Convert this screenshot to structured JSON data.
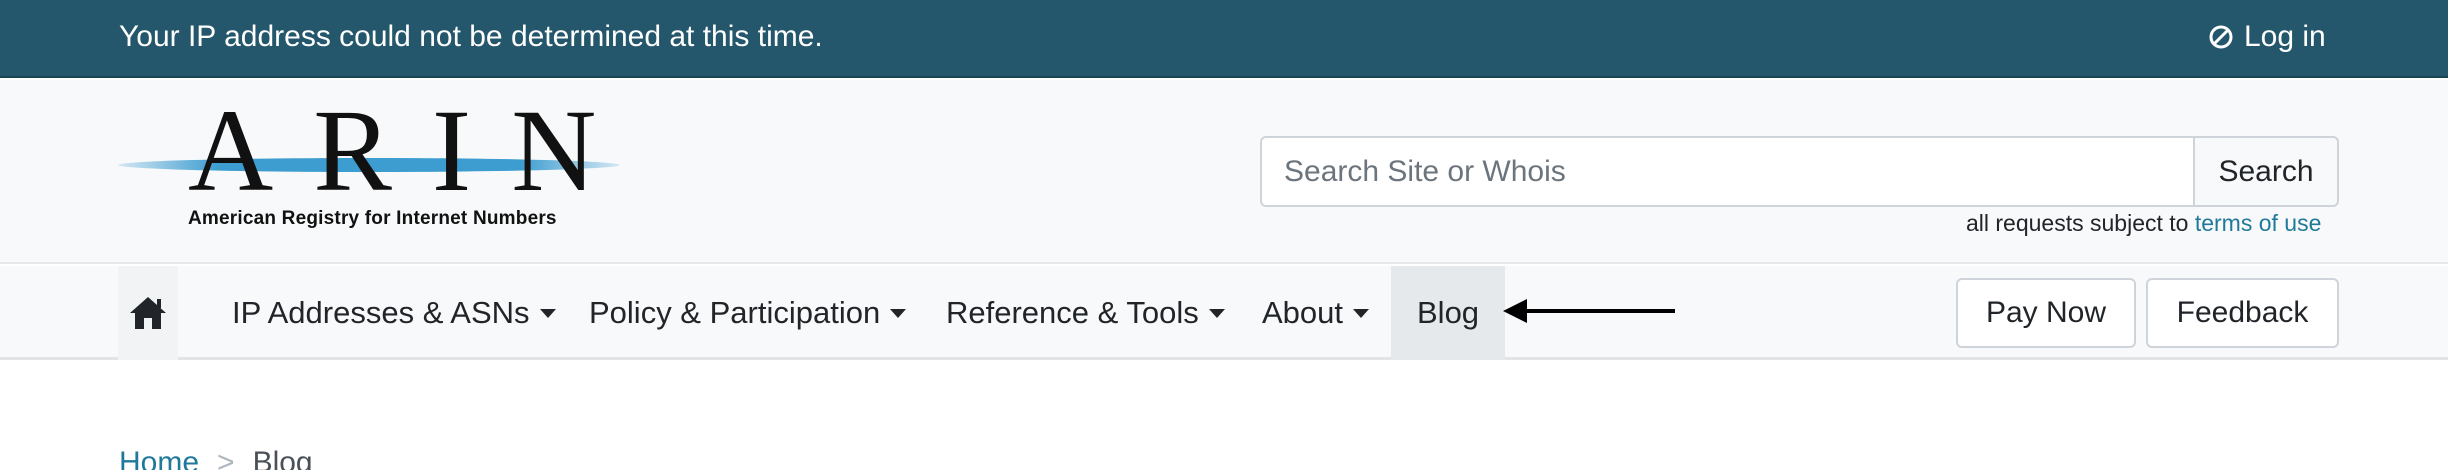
{
  "topbar": {
    "ip_message": "Your IP address could not be determined at this time.",
    "login_label": "Log in",
    "login_icon": "circle-slash-icon",
    "background": "#24576b"
  },
  "logo": {
    "letters": "ARIN",
    "tagline": "American Registry for Internet Numbers"
  },
  "search": {
    "placeholder": "Search Site or Whois",
    "value": "",
    "button_label": "Search",
    "terms_prefix": "all requests subject to",
    "terms_link": "terms of use"
  },
  "nav": {
    "home_icon": "home-icon",
    "items": [
      {
        "label": "IP Addresses & ASNs",
        "dropdown": true
      },
      {
        "label": "Policy & Participation",
        "dropdown": true
      },
      {
        "label": "Reference & Tools",
        "dropdown": true
      },
      {
        "label": "About",
        "dropdown": true
      },
      {
        "label": "Blog",
        "dropdown": false,
        "active": true
      }
    ],
    "pay_now_label": "Pay Now",
    "feedback_label": "Feedback",
    "annotation_icon": "left-arrow-icon"
  },
  "breadcrumb": {
    "home": "Home",
    "separator": ">",
    "current": "Blog"
  },
  "colors": {
    "link": "#20799b",
    "accent_blue": "#3d9dd0"
  }
}
